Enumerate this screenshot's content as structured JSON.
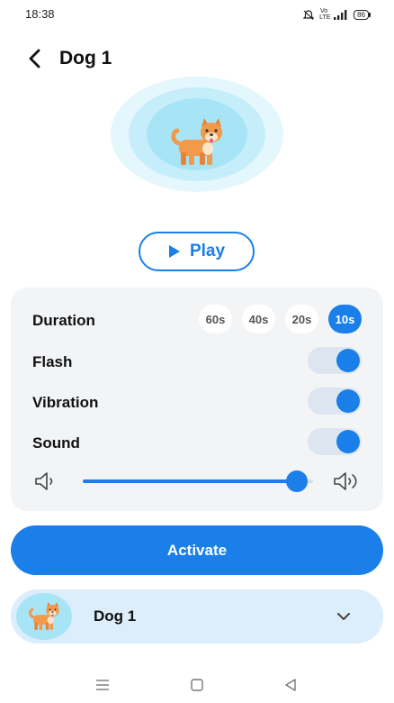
{
  "status_bar": {
    "time": "18:38",
    "network": "Vo LTE",
    "battery": "86"
  },
  "header": {
    "title": "Dog 1"
  },
  "hero": {
    "icon": "dog-icon"
  },
  "play_button": {
    "label": "Play",
    "icon": "play-icon"
  },
  "settings": {
    "duration": {
      "label": "Duration",
      "options": [
        "60s",
        "40s",
        "20s",
        "10s"
      ],
      "selected": "10s"
    },
    "flash": {
      "label": "Flash",
      "on": true
    },
    "vibration": {
      "label": "Vibration",
      "on": true
    },
    "sound": {
      "label": "Sound",
      "on": true
    },
    "volume": {
      "level": 0.93
    }
  },
  "activate_button": {
    "label": "Activate"
  },
  "selector": {
    "label": "Dog 1",
    "icon": "dog-icon"
  },
  "colors": {
    "accent": "#1a7fe8",
    "card_bg": "#f3f4f6",
    "selector_bg": "#dcedfb",
    "hero_rings": [
      "#e3f7fd",
      "#c6eefa",
      "#a7e5f6"
    ]
  }
}
